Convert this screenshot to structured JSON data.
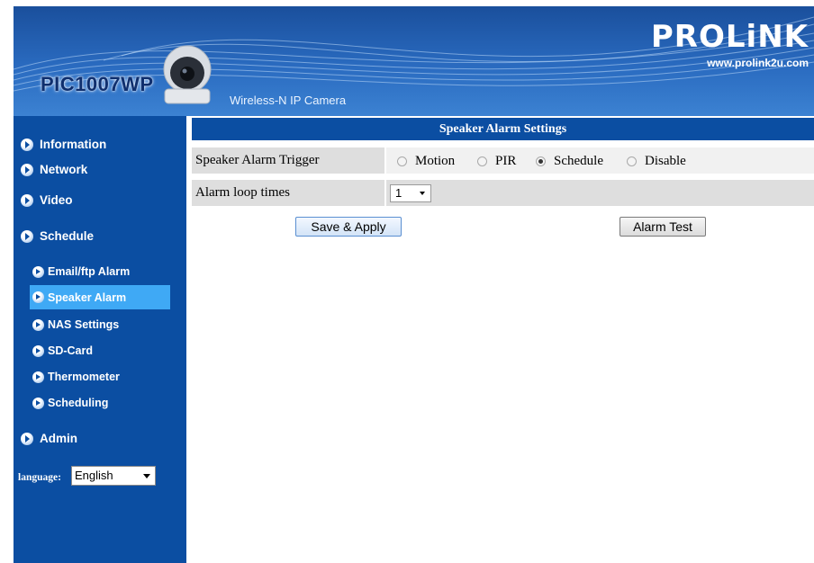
{
  "header": {
    "model": "PIC1007WP",
    "subtitle": "Wireless-N IP Camera",
    "brand": "PROLiNK",
    "brand_url": "www.prolink2u.com"
  },
  "sidebar": {
    "items": [
      {
        "label": "Information",
        "icon": "arrow-circle-icon"
      },
      {
        "label": "Network",
        "icon": "arrow-circle-icon"
      },
      {
        "label": "Video",
        "icon": "arrow-circle-icon"
      },
      {
        "label": "Schedule",
        "icon": "arrow-circle-icon"
      },
      {
        "label": "Email/ftp Alarm",
        "icon": "arrow-circle-icon",
        "sub": true
      },
      {
        "label": "Speaker Alarm",
        "icon": "arrow-circle-icon",
        "sub": true,
        "active": true
      },
      {
        "label": "NAS Settings",
        "icon": "arrow-circle-icon",
        "sub": true
      },
      {
        "label": "SD-Card",
        "icon": "arrow-circle-icon",
        "sub": true
      },
      {
        "label": "Thermometer",
        "icon": "arrow-circle-icon",
        "sub": true
      },
      {
        "label": "Scheduling",
        "icon": "arrow-circle-icon",
        "sub": true
      },
      {
        "label": "Admin",
        "icon": "arrow-circle-icon"
      }
    ],
    "language_label": "language:",
    "language_value": "English"
  },
  "main": {
    "title": "Speaker Alarm Settings",
    "trigger_label": "Speaker Alarm Trigger",
    "trigger_options": [
      "Motion",
      "PIR",
      "Schedule",
      "Disable"
    ],
    "trigger_selected": "Schedule",
    "loop_label": "Alarm loop times",
    "loop_value": "1",
    "save_label": "Save & Apply",
    "test_label": "Alarm Test"
  },
  "colors": {
    "sidebar_bg": "#0b4ea2",
    "active_item": "#3fa9f5",
    "header_bg": "#2a6bc0",
    "row_dark": "#dedede",
    "row_light": "#f1f1f1"
  }
}
